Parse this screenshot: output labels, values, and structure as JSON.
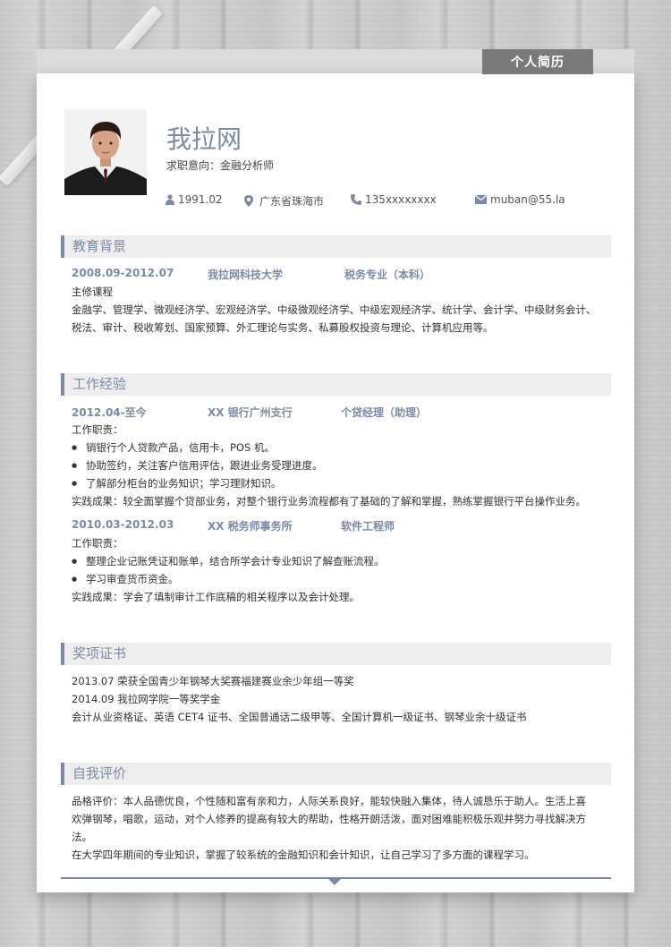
{
  "header": {
    "tab_label": "个人简历"
  },
  "profile": {
    "name": "我拉网",
    "intent": "求职意向：金融分析师",
    "birth": "1991.02",
    "location": "广东省珠海市",
    "phone": "135xxxxxxxx",
    "email": "muban@55.la"
  },
  "education": {
    "title": "教育背景",
    "period": "2008.09-2012.07",
    "school": "我拉网科技大学",
    "major": "税务专业（本科）",
    "course_label": "主修课程",
    "courses_line1": "金融学、管理学、微观经济学、宏观经济学、中级微观经济学、中级宏观经济学、统计学、会计学、中级财务会计、",
    "courses_line2": "税法、审计、税收筹划、国家预算、外汇理论与实务、私募股权投资与理论、计算机应用等。"
  },
  "work": {
    "title": "工作经验",
    "jobs": [
      {
        "period": "2012.04-至今",
        "company": "XX 银行广州支行",
        "role": "个贷经理（助理）",
        "duty_label": "工作职责：",
        "duties": [
          "销银行个人贷款产品，信用卡，POS 机。",
          "协助签约，关注客户信用评估，跟进业务受理进度。",
          "了解部分柜台的业务知识；学习理财知识。"
        ],
        "result": "实践成果：较全面掌握个贷部业务，对整个银行业务流程都有了基础的了解和掌握，熟练掌握银行平台操作业务。"
      },
      {
        "period": "2010.03-2012.03",
        "company": "XX 税务师事务所",
        "role": "软件工程师",
        "duty_label": "工作职责：",
        "duties": [
          "整理企业记账凭证和账单，结合所学会计专业知识了解查账流程。",
          "学习审查货币资金。"
        ],
        "result": "实践成果：学会了填制审计工作底稿的相关程序以及会计处理。"
      }
    ]
  },
  "awards": {
    "title": "奖项证书",
    "lines": [
      "2013.07  荣获全国青少年钢琴大奖赛福建赛业余少年组一等奖",
      "2014.09  我拉网学院一等奖学金",
      "会计从业资格证、英语 CET4 证书、全国普通话二级甲等、全国计算机一级证书、钢琴业余十级证书"
    ]
  },
  "self": {
    "title": "自我评价",
    "lines": [
      "品格评价：本人品德优良，个性随和富有亲和力，人际关系良好，能较快融入集体，待人诚恳乐于助人。生活上喜",
      "欢弹钢琴，唱歌，运动，对个人修养的提高有较大的帮助，性格开朗活泼，面对困难能积极乐观并努力寻找解决方",
      "法。",
      "在大学四年期间的专业知识，掌握了较系统的金融知识和会计知识，让自己学习了多方面的课程学习。"
    ]
  },
  "colors": {
    "accent": "#7d8aa6",
    "tab": "#7a7a7a"
  }
}
